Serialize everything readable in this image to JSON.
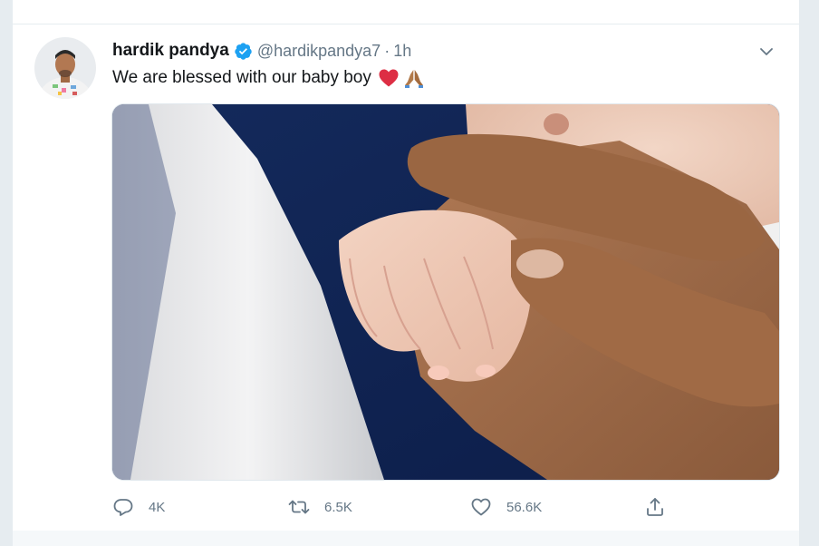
{
  "tweet": {
    "display_name": "hardik pandya",
    "handle": "@hardikpandya7",
    "separator": "·",
    "time": "1h",
    "text": "We are blessed with our baby boy",
    "emojis": [
      "red-heart-icon",
      "folded-hands-icon"
    ],
    "media_alt": "baby hand holding adult finger photo"
  },
  "actions": {
    "reply_count": "4K",
    "retweet_count": "6.5K",
    "like_count": "56.6K"
  },
  "colors": {
    "verified_blue": "#1da1f2",
    "text_primary": "#14171a",
    "text_secondary": "#657786",
    "heart_red": "#e0245e"
  }
}
